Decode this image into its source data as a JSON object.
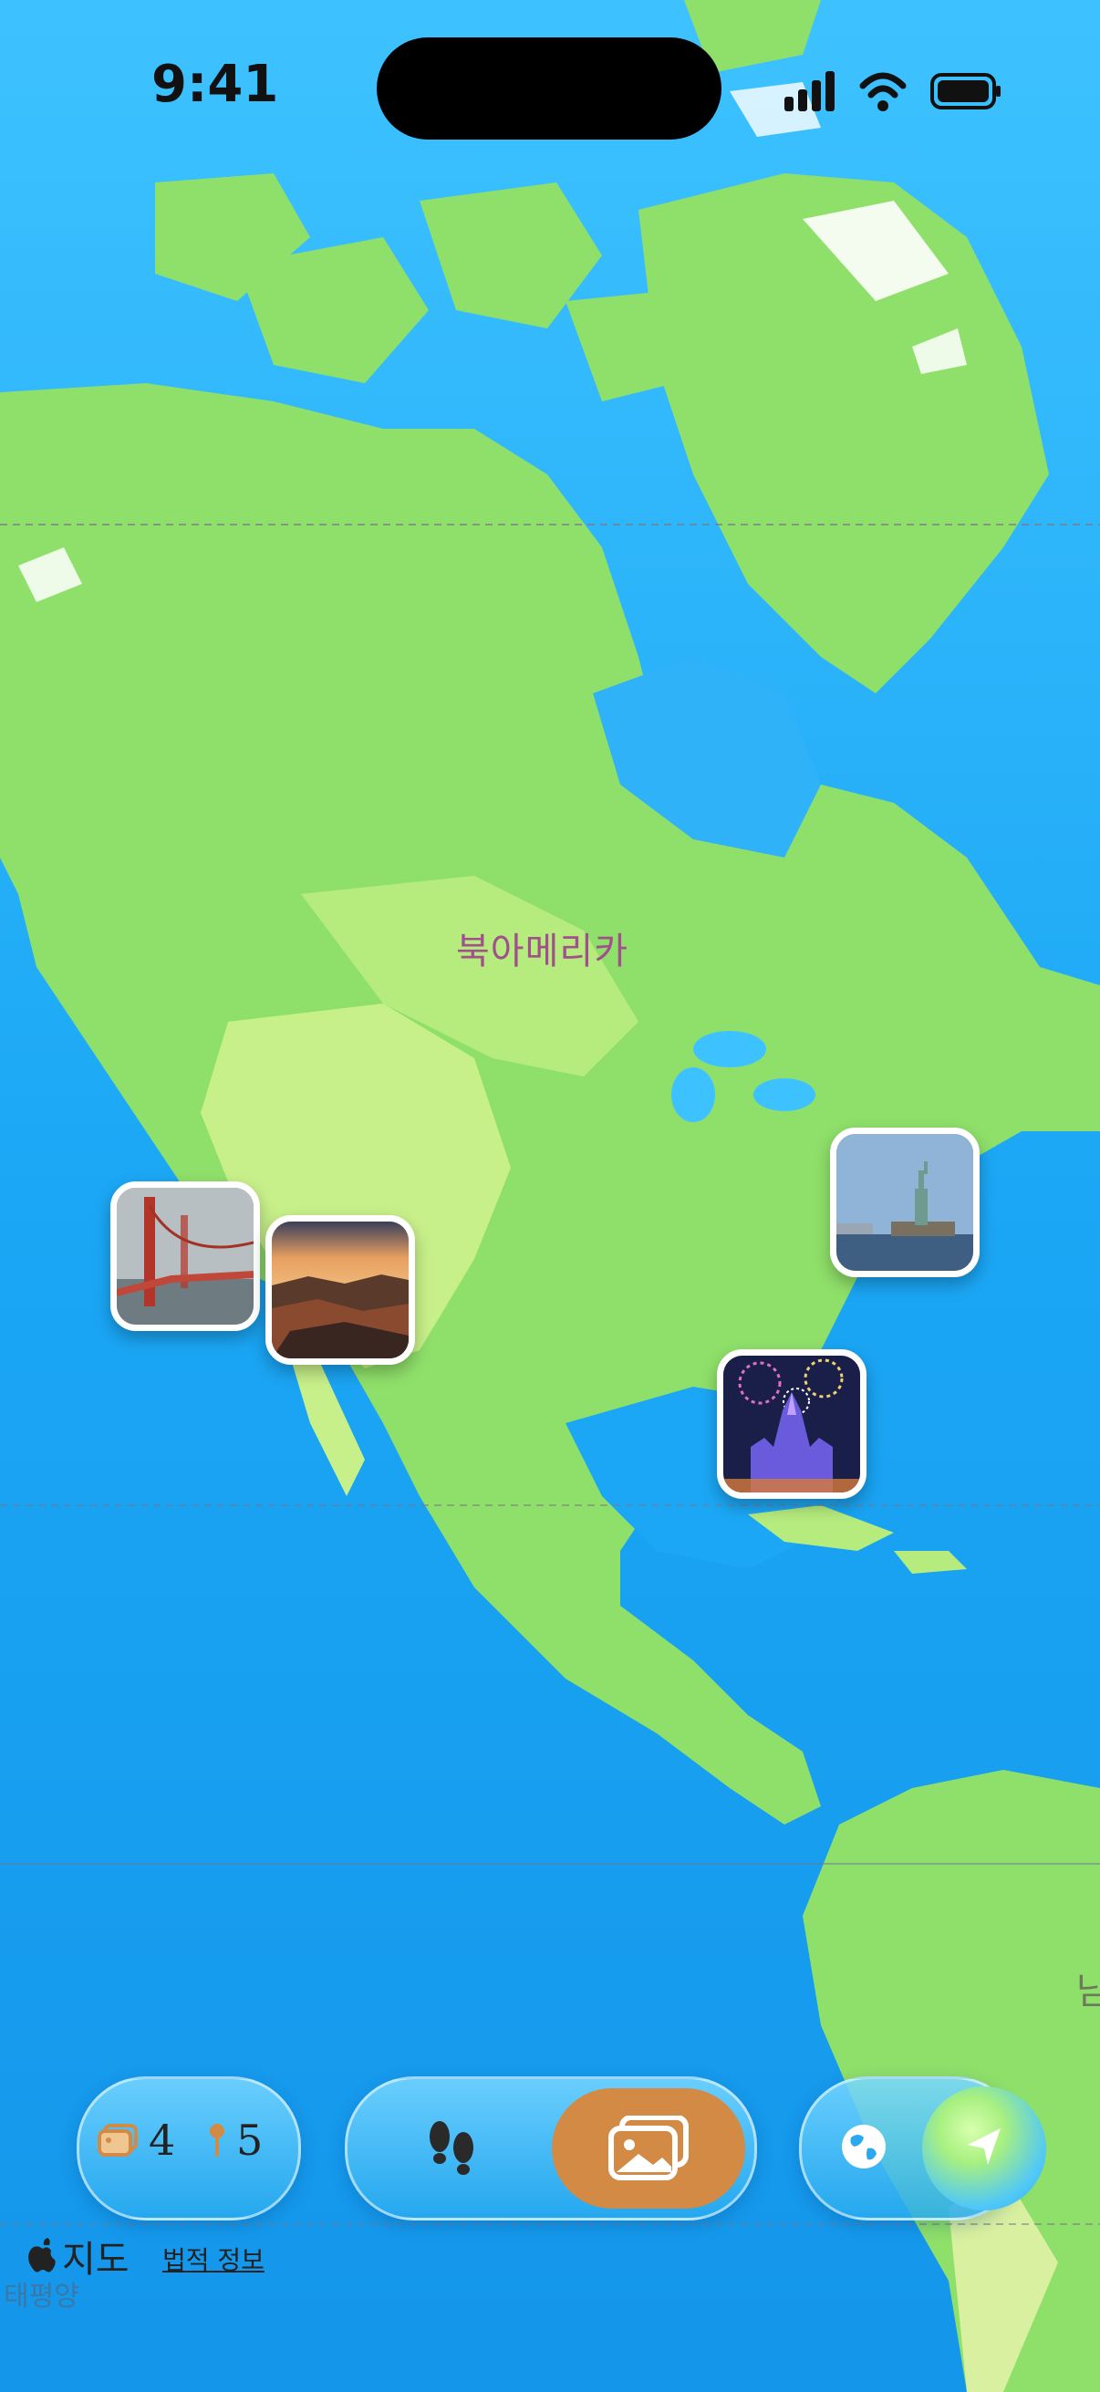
{
  "status_bar": {
    "time": "9:41"
  },
  "map": {
    "continent_label": "북아메리카",
    "edge_label": "남",
    "ocean_label": "태평양",
    "colors": {
      "ocean": "#1aa0f0",
      "land": "#8fe06a",
      "land_light": "#c8f08a",
      "ice": "#ffffff"
    }
  },
  "photo_pins": [
    {
      "name": "golden-gate-bridge-photo"
    },
    {
      "name": "grand-canyon-photo"
    },
    {
      "name": "statue-of-liberty-photo"
    },
    {
      "name": "castle-fireworks-photo"
    }
  ],
  "toolbar": {
    "stats": {
      "photos_icon": "photo-stack-icon",
      "photos_count": "4",
      "pins_icon": "pin-icon",
      "pins_count": "5"
    },
    "modes": [
      {
        "icon": "footprints-icon",
        "active": false
      },
      {
        "icon": "photos-icon",
        "active": true
      }
    ],
    "view": {
      "globe_icon": "globe-icon",
      "location_icon": "location-arrow-icon"
    },
    "accent": "#d28a45"
  },
  "footer": {
    "maps_logo_text": "지도",
    "legal_label": "법적 정보"
  }
}
